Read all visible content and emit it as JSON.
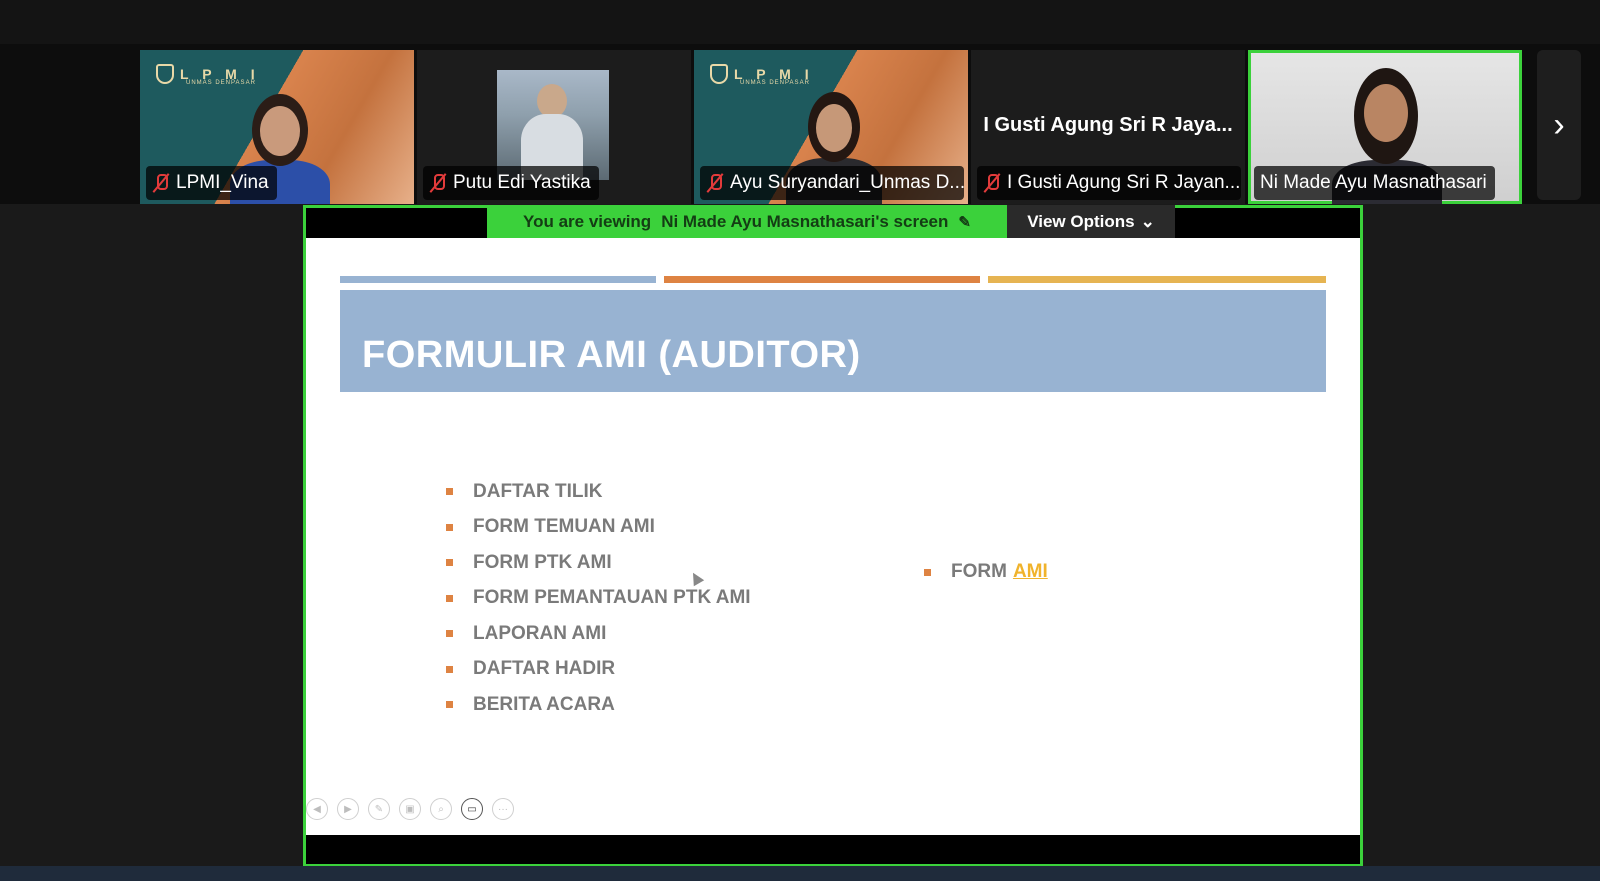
{
  "participants": [
    {
      "name": "LPMI_Vina",
      "muted": true,
      "logo": "L P M I",
      "logo_sub": "UNMAS DENPASAR"
    },
    {
      "name": "Putu Edi Yastika",
      "muted": true
    },
    {
      "name": "Ayu Suryandari_Unmas D...",
      "muted": true,
      "logo": "L P M I",
      "logo_sub": "UNMAS DENPASAR"
    },
    {
      "name": "I Gusti Agung Sri R Jayan...",
      "muted": true,
      "display_name": "I Gusti Agung Sri R Jaya..."
    },
    {
      "name": "Ni Made Ayu Masnathasari",
      "muted": false,
      "active": true
    }
  ],
  "next_icon": "chevron-right-icon",
  "share": {
    "viewing_prefix": "You are viewing",
    "viewing_name": "Ni Made Ayu Masnathasari's screen",
    "view_options": "View Options",
    "accent": "#3bd13b"
  },
  "slide": {
    "title": "FORMULIR AMI (AUDITOR)",
    "rule_colors": [
      "#98b3d2",
      "#de8342",
      "#e6b452"
    ],
    "bullets": [
      "DAFTAR TILIK",
      "FORM TEMUAN AMI",
      "FORM PTK AMI",
      "FORM PEMANTAUAN PTK AMI",
      "LAPORAN AMI",
      "DAFTAR HADIR",
      "BERITA ACARA"
    ],
    "right_bullet": {
      "prefix": "FORM",
      "link": "AMI"
    }
  }
}
